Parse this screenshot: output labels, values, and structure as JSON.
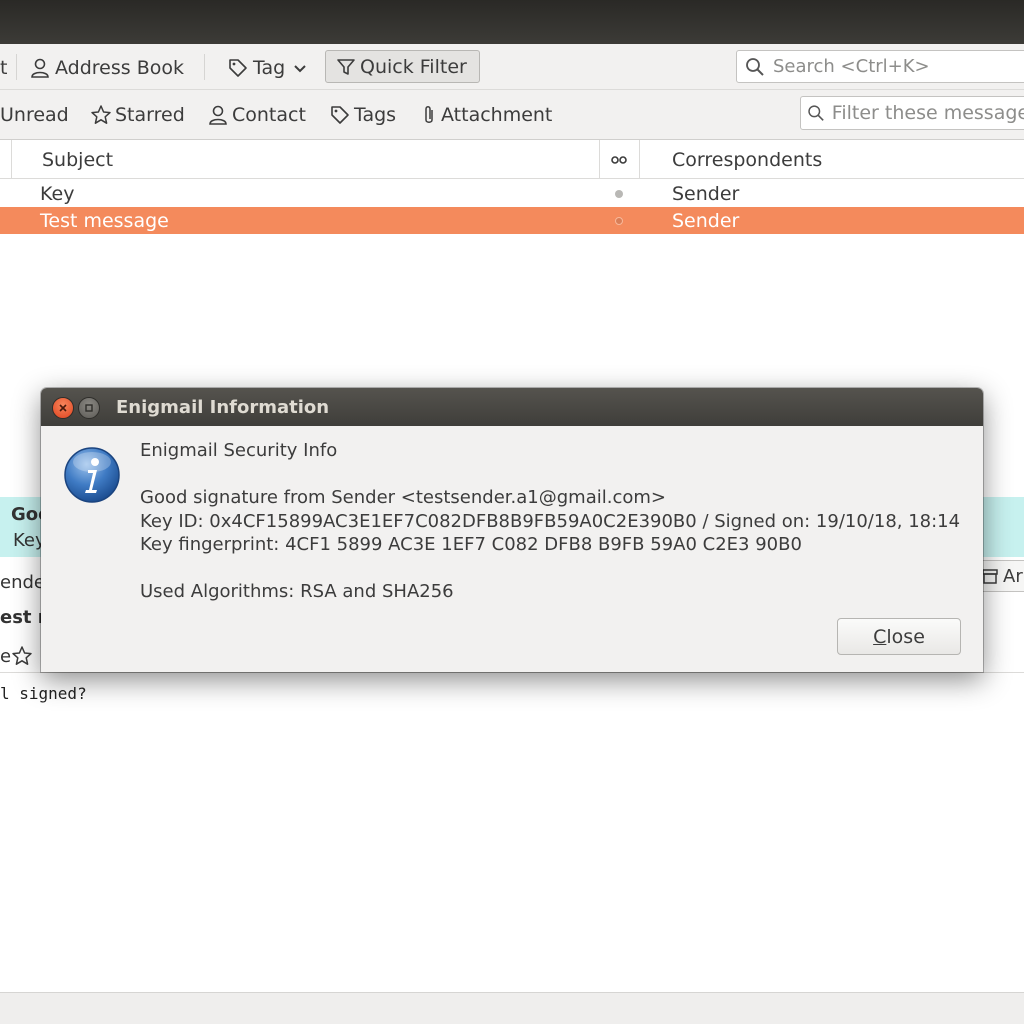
{
  "toolbar": {
    "cut_prefix": "t",
    "address_book": "Address Book",
    "tag": "Tag",
    "quick_filter": "Quick Filter",
    "search_placeholder": "Search <Ctrl+K>"
  },
  "filterbar": {
    "unread": "Unread",
    "starred": "Starred",
    "contact": "Contact",
    "tags": "Tags",
    "attachment": "Attachment",
    "filter_placeholder": "Filter these messages"
  },
  "columns": {
    "subject": "Subject",
    "correspondents": "Correspondents"
  },
  "messages": [
    {
      "subject": "Key",
      "correspondent": "Sender",
      "selected": false
    },
    {
      "subject": "Test message",
      "correspondent": "Sender",
      "selected": true
    }
  ],
  "preview": {
    "line1": "Goo",
    "line2": "Key",
    "from_cut": "ende",
    "subject_cut": "est m",
    "star_prefix": "e",
    "archive_cut": "Ar",
    "body_cut": "l signed?"
  },
  "dialog": {
    "title": "Enigmail Information",
    "heading": "Enigmail Security Info",
    "signature": "Good signature from Sender <testsender.a1@gmail.com>",
    "key_id": "Key ID: 0x4CF15899AC3E1EF7C082DFB8B9FB59A0C2E390B0 / Signed on: 19/10/18, 18:14",
    "fingerprint": "Key fingerprint: 4CF1 5899 AC3E 1EF7 C082 DFB8 B9FB 59A0 C2E3 90B0",
    "algorithms": "Used Algorithms: RSA and SHA256",
    "close_mnemonic": "C",
    "close_rest": "lose"
  },
  "colors": {
    "selection": "#f48a5c",
    "notification": "#c7f1ef",
    "dialog_title": "#3f3e3a"
  },
  "icons": [
    "address-book-icon",
    "tag-icon",
    "chevron-down-icon",
    "filter-icon",
    "search-icon",
    "star-icon",
    "contact-icon",
    "paperclip-icon",
    "read-status-icon",
    "close-window-icon",
    "maximize-icon",
    "info-icon",
    "archive-icon"
  ]
}
